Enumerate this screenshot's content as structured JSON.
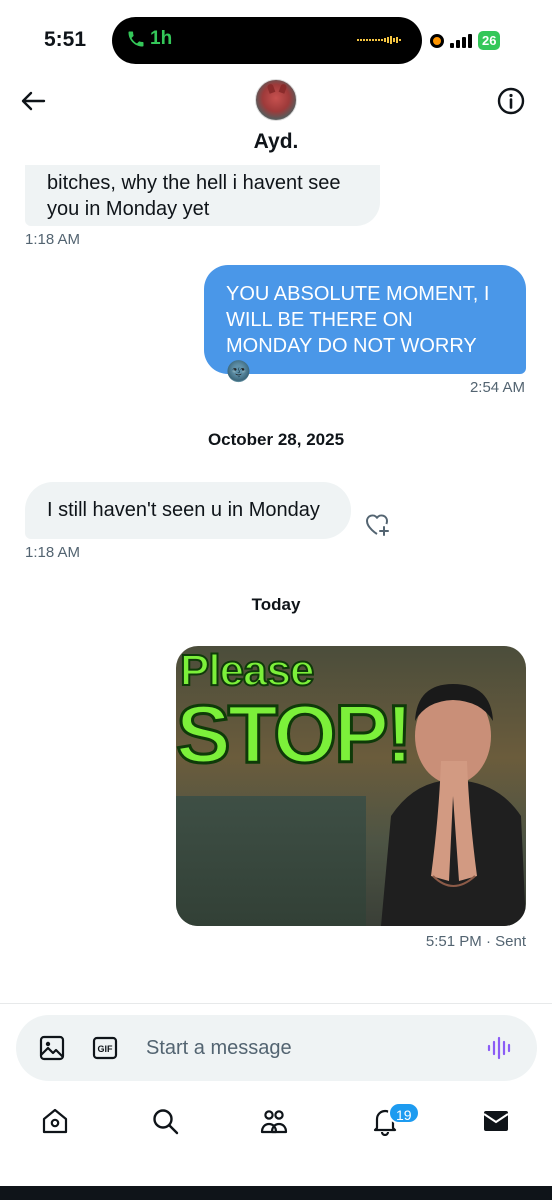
{
  "status_bar": {
    "time": "5:51",
    "call_duration": "1h",
    "battery": "26"
  },
  "header": {
    "contact_name": "Ayd."
  },
  "messages": [
    {
      "direction": "incoming",
      "text": "bitches, why the hell i havent see you in Monday yet",
      "time": "1:18 AM"
    },
    {
      "direction": "outgoing",
      "text": "YOU ABSOLUTE MOMENT, I WILL BE THERE ON MONDAY DO NOT WORRY 🌚",
      "time": "2:54 AM"
    },
    {
      "direction": "incoming",
      "text": "I still haven't seen u in Monday",
      "time": "1:18 AM"
    },
    {
      "direction": "outgoing",
      "type": "gif",
      "gif_text_line1": "Please",
      "gif_text_line2": "STOP!",
      "time": "5:51 PM",
      "status": "· Sent"
    }
  ],
  "date_separators": [
    "October 28, 2025",
    "Today"
  ],
  "composer": {
    "placeholder": "Start a message"
  },
  "tabbar": {
    "notifications_badge": "19"
  },
  "colors": {
    "outgoing_bubble": "#4a97e8",
    "incoming_bubble": "#eff3f4",
    "accent": "#1d9bf0",
    "voice_icon": "#8b5cf6"
  }
}
